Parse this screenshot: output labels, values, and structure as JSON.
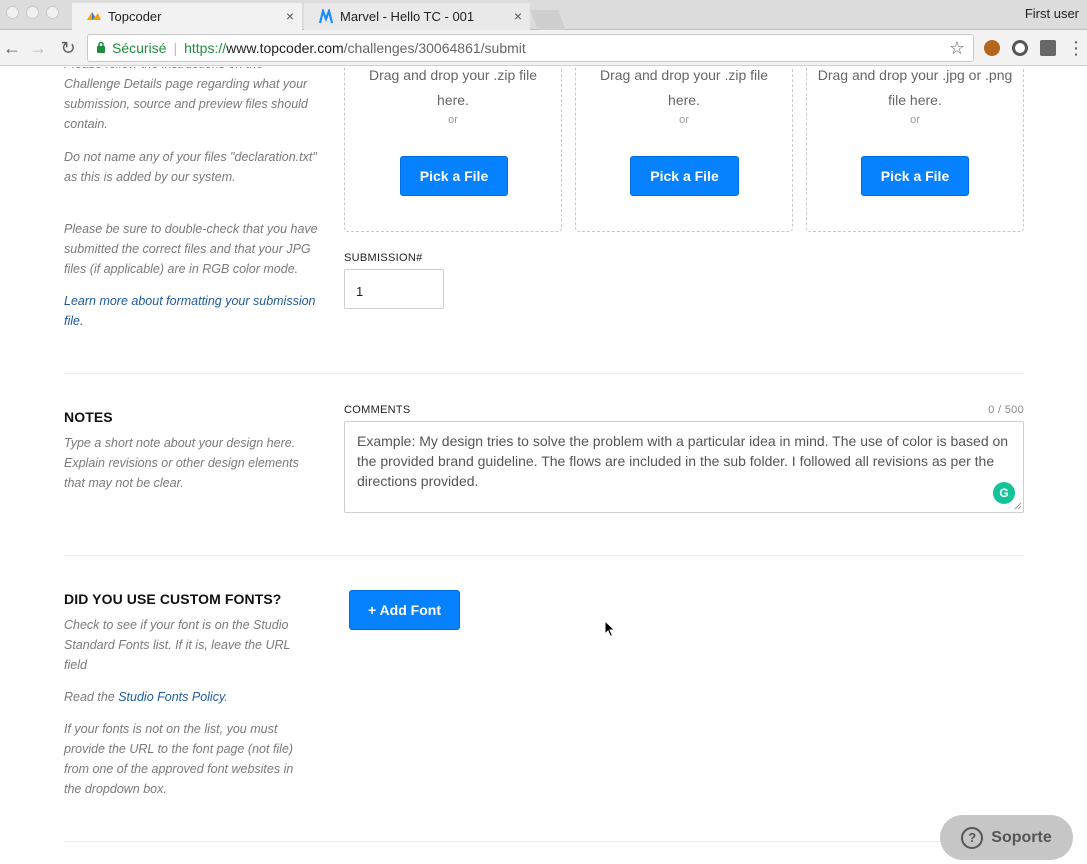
{
  "browser": {
    "tabs": [
      {
        "title": "Topcoder",
        "close": "×"
      },
      {
        "title": "Marvel - Hello TC - 001",
        "close": "×"
      }
    ],
    "user": "First user",
    "secure_label": "Sécurisé",
    "url_scheme": "https://",
    "url_host": "www.topcoder.com",
    "url_path": "/challenges/30064861/submit"
  },
  "files": {
    "help_p1": "Please follow the instructions on the Challenge Details page regarding what your submission, source and preview files should contain.",
    "help_p2": "Do not name any of your files \"declaration.txt\" as this is added by our system.",
    "help_p3": "Please be sure to double-check that you have submitted the correct files and that your JPG files (if applicable) are in RGB color mode.",
    "help_link": "Learn more about formatting your submission file.",
    "dropzones": [
      {
        "text": "Drag and drop your .zip file here.",
        "or": "or",
        "button": "Pick a File"
      },
      {
        "text": "Drag and drop your .zip file here.",
        "or": "or",
        "button": "Pick a File"
      },
      {
        "text": "Drag and drop your .jpg or .png file here.",
        "or": "or",
        "button": "Pick a File"
      }
    ],
    "submission_label": "SUBMISSION#",
    "submission_value": "1"
  },
  "notes": {
    "title": "NOTES",
    "help": "Type a short note about your design here. Explain revisions or other design elements that may not be clear.",
    "comments_label": "COMMENTS",
    "counter": "0 / 500",
    "placeholder": "Example: My design tries to solve the problem with a particular idea in mind. The use of color is based on the provided brand guideline. The flows are included in the sub folder. I followed all revisions as per the directions provided.",
    "grammarly_glyph": "G"
  },
  "fonts": {
    "title": "DID YOU USE CUSTOM FONTS?",
    "help_p1": "Check to see if your font is on the Studio Standard Fonts list. If it is, leave the URL field",
    "help_p2_prefix": "Read the ",
    "help_p2_link": "Studio Fonts Policy",
    "help_p2_suffix": ".",
    "help_p3": "If your fonts is not on the list, you must provide the URL to the font page (not file) from one of the approved font websites in the dropdown box.",
    "add_button": "+ Add Font"
  },
  "support": {
    "label": "Soporte",
    "icon": "?"
  },
  "colors": {
    "primary": "#0681ff",
    "link": "#1f5a9e",
    "secure": "#1e8e3e"
  }
}
